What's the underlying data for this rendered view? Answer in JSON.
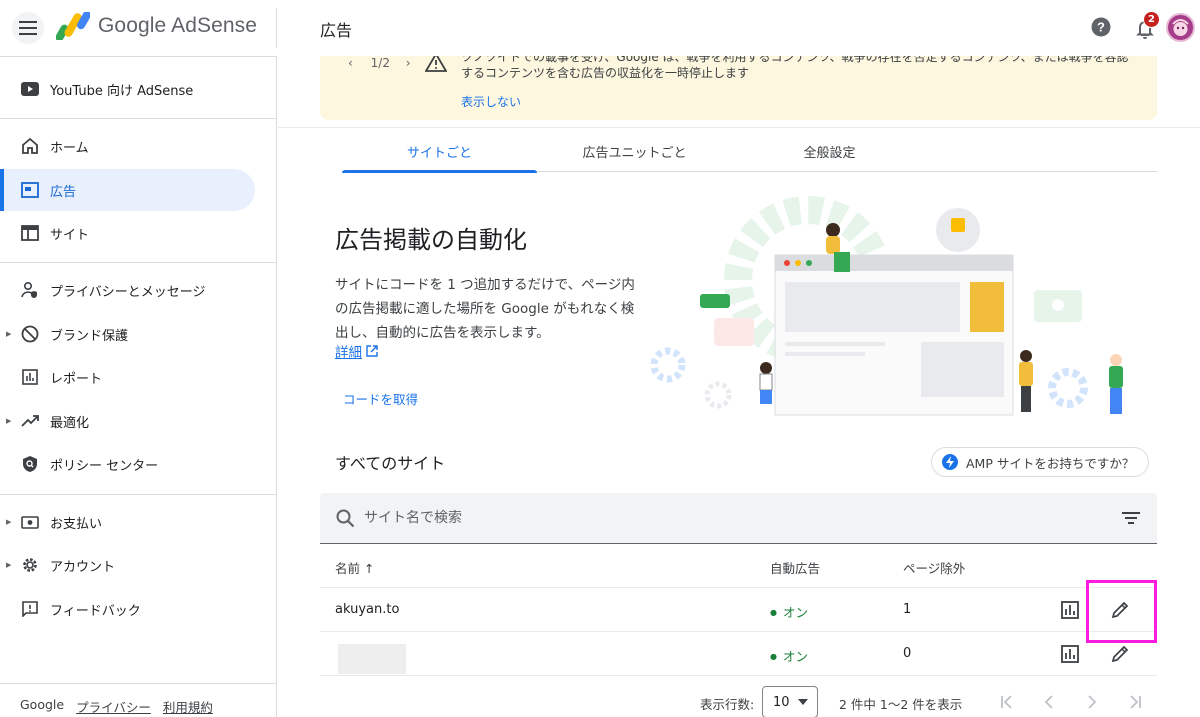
{
  "app": {
    "logo_text": "Google AdSense",
    "page_title": "広告",
    "notification_count": "2"
  },
  "sidebar": {
    "items": [
      {
        "label": "YouTube 向け AdSense",
        "icon": "youtube-icon"
      },
      {
        "label": "ホーム",
        "icon": "home-icon"
      },
      {
        "label": "広告",
        "icon": "ads-icon",
        "active": true
      },
      {
        "label": "サイト",
        "icon": "sites-icon"
      },
      {
        "label": "プライバシーとメッセージ",
        "icon": "privacy-icon"
      },
      {
        "label": "ブランド保護",
        "icon": "block-icon"
      },
      {
        "label": "レポート",
        "icon": "report-icon"
      },
      {
        "label": "最適化",
        "icon": "trending-icon"
      },
      {
        "label": "ポリシー センター",
        "icon": "policy-icon"
      },
      {
        "label": "お支払い",
        "icon": "payments-icon"
      },
      {
        "label": "アカウント",
        "icon": "gear-icon"
      },
      {
        "label": "フィードバック",
        "icon": "feedback-icon"
      }
    ],
    "footer": {
      "brand": "Google",
      "privacy": "プライバシー",
      "terms": "利用規約"
    }
  },
  "alert": {
    "pager": "1/2",
    "line1": "ツノツイトでの載事を受け、Google は、戦争を利用するコンテンツ、戦争の存在を否定するコンテンツ、または戦争を容認",
    "line2": "するコンテンツを含む広告の収益化を一時停止します",
    "dismiss": "表示しない",
    "accent_color": "#fef7e0"
  },
  "tabs": [
    {
      "label": "サイトごと",
      "active": true
    },
    {
      "label": "広告ユニットごと"
    },
    {
      "label": "全般設定"
    }
  ],
  "promo": {
    "title": "広告掲載の自動化",
    "description": "サイトにコードを 1 つ追加するだけで、ページ内の広告掲載に適した場所を Google がもれなく検出し、自動的に広告を表示します。",
    "learn_more": "詳細",
    "get_code": "コードを取得"
  },
  "sites": {
    "heading": "すべてのサイト",
    "amp_chip": "AMP サイトをお持ちですか？",
    "search_placeholder": "サイト名で検索",
    "columns": {
      "name": "名前 ↑",
      "auto_ads": "自動広告",
      "page_exclusions": "ページ除外"
    },
    "rows": [
      {
        "name": "akuyan.to",
        "auto_ads": "オン",
        "exclusions": "1"
      },
      {
        "name": "",
        "auto_ads": "オン",
        "exclusions": "0"
      }
    ]
  },
  "pagination": {
    "rows_label": "表示行数:",
    "rows_value": "10",
    "range": "2 件中 1〜2 件を表示"
  },
  "colors": {
    "primary": "#1a73e8",
    "status_on": "#188038",
    "highlight": "#ff1ae0"
  }
}
